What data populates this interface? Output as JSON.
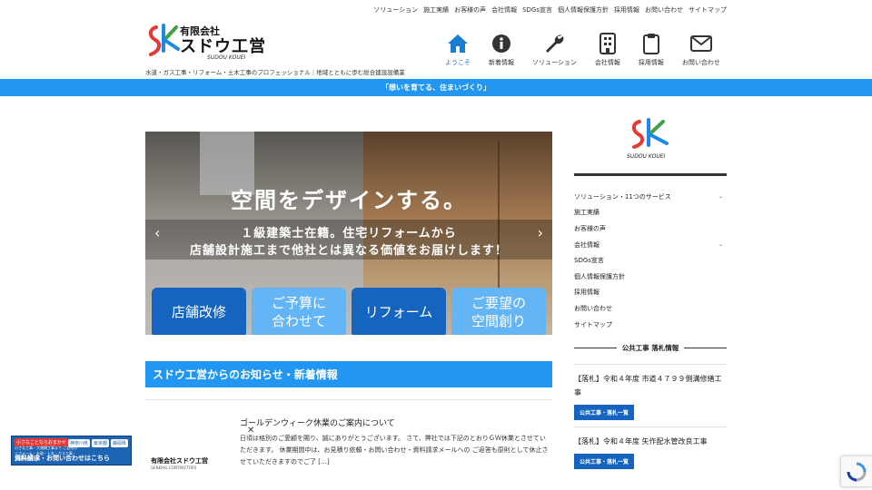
{
  "utility_nav": [
    "ソリューション",
    "施工実績",
    "お客様の声",
    "会社情報",
    "SDGs宣言",
    "個人情報保護方針",
    "採用情報",
    "お問い合わせ",
    "サイトマップ"
  ],
  "logo": {
    "company_prefix": "有限会社",
    "company_name": "スドウ工営",
    "company_roman": "SUDOU KOUEI"
  },
  "tagline": "水道・ガス工事・リフォーム・土木工事のプロフェッショナル｜地域とともに歩む総合建設設備業",
  "main_nav": [
    {
      "label": "ようこそ",
      "icon": "home-icon",
      "active": true
    },
    {
      "label": "新着情報",
      "icon": "info-icon",
      "active": false
    },
    {
      "label": "ソリューション",
      "icon": "wrench-icon",
      "active": false
    },
    {
      "label": "会社情報",
      "icon": "building-icon",
      "active": false
    },
    {
      "label": "採用情報",
      "icon": "clipboard-icon",
      "active": false
    },
    {
      "label": "お問い合わせ",
      "icon": "mail-icon",
      "active": false
    }
  ],
  "banner": "「想いを育てる、住まいづくり」",
  "hero": {
    "headline": "空間をデザインする。",
    "sub_line1": "１級建築士在籍。住宅リフォームから",
    "sub_line2": "店舗設計施工まで他社とは異なる価値をお届けします！",
    "prev": "‹",
    "next": "›",
    "tiles": [
      "店舗改修",
      "ご予算に\n合わせて",
      "リフォーム",
      "ご要望の\n空間創り"
    ]
  },
  "news": {
    "section_title": "スドウ工営からのお知らせ・新着情報",
    "item": {
      "thumb_company": "有限会社スドウ工営",
      "thumb_sub": "GENERAL CONTRACTORS",
      "title": "ゴールデンウィーク休業のご案内について",
      "excerpt": "日頃は格別のご愛顧を賜り、誠にありがとうございます。 さて、弊社では下記のとおりＧＷ休業とさせていただきます。 休業期間中は、お見積り依頼・お問い合わせ・資料請求メールへの ご返答も原則として休止させていただきますのでご了 […]"
    }
  },
  "float_banner": {
    "tag": "小さなことならおまかせ",
    "mini": "小さな工事・大規模工事まで ご自宅のリフォーム・水道・土木・ガス工事・大規模修繕工事",
    "regions": [
      "神奈川県",
      "東京都",
      "静岡県"
    ],
    "cta": "資料請求・お問い合わせはこちら"
  },
  "close_label": "✕",
  "sidebar": {
    "logo_roman": "SUDOU KOUEI",
    "menu": [
      {
        "label": "ソリューション・11つのサービス",
        "chevron": "⌄"
      },
      {
        "label": "施工実績",
        "chevron": ""
      },
      {
        "label": "お客様の声",
        "chevron": ""
      },
      {
        "label": "会社情報",
        "chevron": "⌄"
      },
      {
        "label": "SDGs宣言",
        "chevron": ""
      },
      {
        "label": "個人情報保護方針",
        "chevron": ""
      },
      {
        "label": "採用情報",
        "chevron": ""
      },
      {
        "label": "お問い合わせ",
        "chevron": ""
      },
      {
        "label": "サイトマップ",
        "chevron": ""
      }
    ],
    "section_title": "公共工事 落札情報",
    "posts": [
      {
        "title": "【落札】令和４年度 市道４７９９側溝修繕工事",
        "badge": "公共工事・落札一覧"
      },
      {
        "title": "【落札】令和４年度 矢作配水管改良工事",
        "badge": "公共工事・落札一覧"
      }
    ]
  },
  "colors": {
    "brand_blue": "#2196f3",
    "dark_blue": "#1565c0",
    "light_blue": "#64b5f6"
  }
}
